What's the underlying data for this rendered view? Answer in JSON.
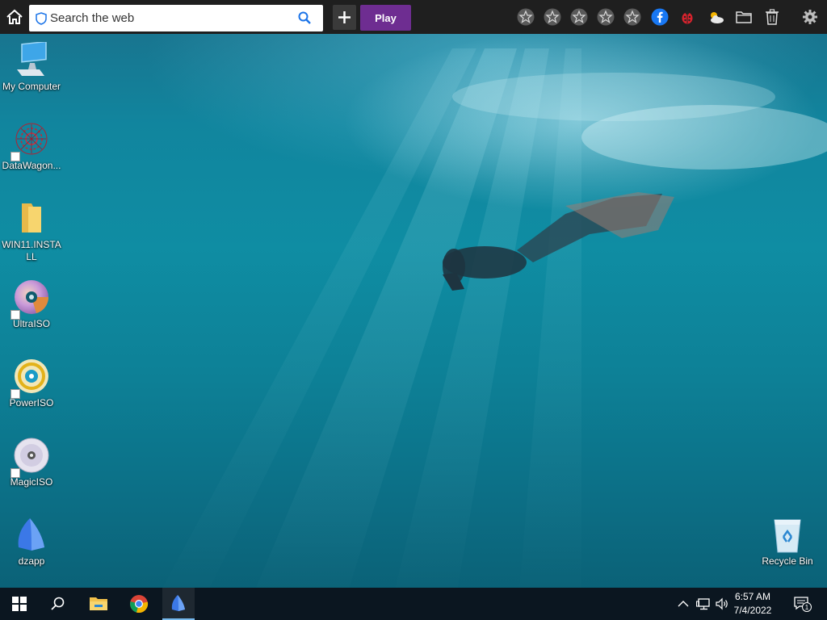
{
  "toolbar": {
    "search_placeholder": "Search the web",
    "play_label": "Play",
    "icons": [
      "home-icon",
      "shield-icon",
      "search-icon",
      "plus-icon",
      "star-icon",
      "star-icon",
      "star-icon",
      "star-icon",
      "star-icon",
      "facebook-icon",
      "ladybug-icon",
      "weather-icon",
      "folder-icon",
      "trash-icon",
      "gear-icon"
    ]
  },
  "desktop": {
    "icons": [
      {
        "label": "My Computer",
        "icon": "computer-icon"
      },
      {
        "label": "DataWagon...",
        "icon": "datawagon-icon"
      },
      {
        "label": "WIN11.INSTALL",
        "icon": "folder-icon"
      },
      {
        "label": "UltraISO",
        "icon": "disc-icon"
      },
      {
        "label": "PowerISO",
        "icon": "poweriso-icon"
      },
      {
        "label": "MagicISO",
        "icon": "cd-icon"
      },
      {
        "label": "dzapp",
        "icon": "dzapp-icon"
      },
      {
        "label": "Recycle Bin",
        "icon": "recycle-bin-icon"
      }
    ]
  },
  "taskbar": {
    "apps": [
      "windows-start-icon",
      "search-icon",
      "file-explorer-icon",
      "chrome-icon",
      "dzapp-icon"
    ],
    "time": "6:57 AM",
    "date": "7/4/2022",
    "notification_count": "1"
  },
  "colors": {
    "toolbar_bg": "#1f1f1f",
    "play_button": "#6e2d91",
    "taskbar_bg": "#0b1620",
    "accent": "#76b9ed"
  }
}
